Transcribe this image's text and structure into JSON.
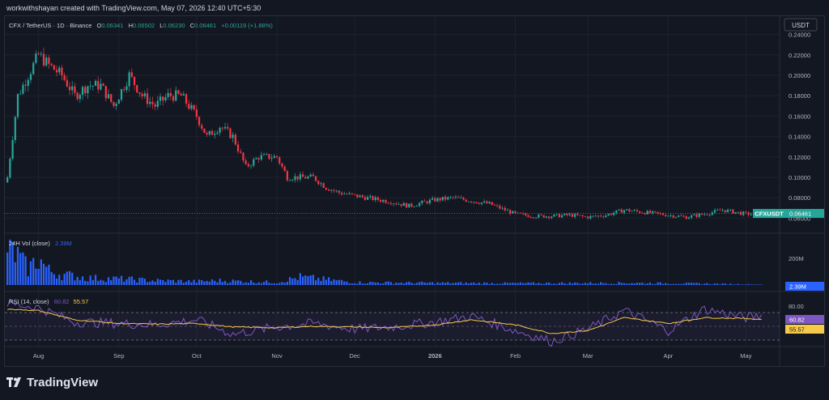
{
  "header": {
    "creator_line": "workwithshayan created with TradingView.com, May 07, 2026 12:40 UTC+5:30"
  },
  "symbol_bar": {
    "title": "CFX / TetherUS · 1D · Binance",
    "o_label": "O",
    "o_value": "0.06341",
    "h_label": "H",
    "h_value": "0.06502",
    "l_label": "L",
    "l_value": "0.06230",
    "c_label": "C",
    "c_value": "0.06461",
    "change": "+0.00119 (+1.88%)"
  },
  "currency_button": "USDT",
  "price_axis": {
    "ticks": [
      "0.24000",
      "0.22000",
      "0.20000",
      "0.18000",
      "0.16000",
      "0.14000",
      "0.12000",
      "0.10000",
      "0.08000",
      "0.06000"
    ],
    "last_price_symbol": "CFXUSDT",
    "last_price_value": "0.06461"
  },
  "volume": {
    "title": "24H Vol (close)",
    "value": "2.39M",
    "axis_tick": "200M",
    "axis_current": "2.39M"
  },
  "rsi": {
    "title": "RSI (14, close)",
    "rsi_value": "60.82",
    "ma_value": "55.57",
    "axis_tick": "80.00",
    "axis_rsi": "60.82",
    "axis_ma": "55.57"
  },
  "time_axis": [
    "Aug",
    "Sep",
    "Oct",
    "Nov",
    "Dec",
    "2026",
    "Feb",
    "Mar",
    "Apr",
    "May"
  ],
  "brand": {
    "name": "TradingView"
  },
  "colors": {
    "up": "#26a69a",
    "down": "#f23645",
    "volume": "#2962ff",
    "rsi_line": "#7e57c2",
    "rsi_ma": "#f7c948",
    "background": "#131722",
    "grid": "#1e222d"
  },
  "chart_data": [
    {
      "type": "line",
      "title": "CFX / TetherUS · 1D · Binance",
      "description_units": "USDT",
      "x": [
        "2025-07-20",
        "2025-07-24",
        "2025-07-28",
        "2025-08-01",
        "2025-08-05",
        "2025-08-10",
        "2025-08-15",
        "2025-08-20",
        "2025-08-25",
        "2025-08-30",
        "2025-09-05",
        "2025-09-10",
        "2025-09-15",
        "2025-09-20",
        "2025-09-25",
        "2025-10-01",
        "2025-10-05",
        "2025-10-10",
        "2025-10-15",
        "2025-10-20",
        "2025-10-25",
        "2025-11-01",
        "2025-11-05",
        "2025-11-10",
        "2025-11-15",
        "2025-11-20",
        "2025-11-25",
        "2025-12-01",
        "2025-12-08",
        "2025-12-15",
        "2025-12-22",
        "2026-01-01",
        "2026-01-08",
        "2026-01-15",
        "2026-01-22",
        "2026-02-01",
        "2026-02-08",
        "2026-02-15",
        "2026-02-22",
        "2026-03-01",
        "2026-03-08",
        "2026-03-15",
        "2026-03-22",
        "2026-04-01",
        "2026-04-08",
        "2026-04-15",
        "2026-04-22",
        "2026-05-01",
        "2026-05-07"
      ],
      "series": [
        {
          "values": [
            0.1,
            0.18,
            0.2,
            0.22,
            0.21,
            0.2,
            0.18,
            0.19,
            0.19,
            0.17,
            0.2,
            0.18,
            0.17,
            0.18,
            0.18,
            0.16,
            0.14,
            0.15,
            0.14,
            0.11,
            0.12,
            0.12,
            0.1,
            0.1,
            0.1,
            0.09,
            0.085,
            0.082,
            0.079,
            0.076,
            0.072,
            0.078,
            0.08,
            0.077,
            0.074,
            0.064,
            0.062,
            0.062,
            0.063,
            0.061,
            0.063,
            0.068,
            0.066,
            0.063,
            0.061,
            0.064,
            0.068,
            0.064,
            0.0646
          ]
        }
      ],
      "ylim": [
        0.05,
        0.25
      ],
      "yticks": [
        "0.24000",
        "0.22000",
        "0.20000",
        "0.18000",
        "0.16000",
        "0.14000",
        "0.12000",
        "0.10000",
        "0.08000",
        "0.06000"
      ],
      "last_value": 0.06461,
      "grid": true
    },
    {
      "type": "bar",
      "title": "24H Vol (close)",
      "x": [
        "2025-07-20",
        "2025-07-24",
        "2025-07-28",
        "2025-08-01",
        "2025-08-05",
        "2025-08-10",
        "2025-08-20",
        "2025-09-01",
        "2025-09-15",
        "2025-10-01",
        "2025-10-10",
        "2025-11-01",
        "2025-11-10",
        "2025-12-01",
        "2026-01-01",
        "2026-02-01",
        "2026-03-15",
        "2026-04-15",
        "2026-05-07"
      ],
      "values": [
        220,
        160,
        90,
        150,
        80,
        60,
        40,
        35,
        25,
        20,
        25,
        15,
        45,
        15,
        12,
        10,
        12,
        8,
        2.39
      ],
      "units": "M",
      "yticks": [
        "200M"
      ],
      "last_value": "2.39M"
    },
    {
      "type": "line",
      "title": "RSI (14, close)",
      "x": [
        "2025-07-20",
        "2025-08-01",
        "2025-08-15",
        "2025-09-01",
        "2025-09-15",
        "2025-10-01",
        "2025-10-15",
        "2025-11-01",
        "2025-11-15",
        "2025-12-01",
        "2025-12-15",
        "2026-01-01",
        "2026-01-15",
        "2026-02-01",
        "2026-02-15",
        "2026-03-01",
        "2026-03-15",
        "2026-04-01",
        "2026-04-15",
        "2026-05-01",
        "2026-05-07"
      ],
      "series": [
        {
          "name": "RSI",
          "values": [
            78,
            72,
            52,
            50,
            48,
            55,
            35,
            45,
            50,
            42,
            45,
            52,
            60,
            40,
            25,
            42,
            68,
            40,
            70,
            58,
            60.82
          ]
        },
        {
          "name": "MA",
          "values": [
            70,
            68,
            55,
            50,
            49,
            50,
            45,
            44,
            46,
            45,
            44,
            48,
            55,
            48,
            36,
            40,
            58,
            50,
            58,
            57,
            55.57
          ]
        }
      ],
      "ylim": [
        20,
        90
      ],
      "yticks": [
        "80.00"
      ],
      "bands": [
        70,
        50,
        30
      ]
    }
  ]
}
